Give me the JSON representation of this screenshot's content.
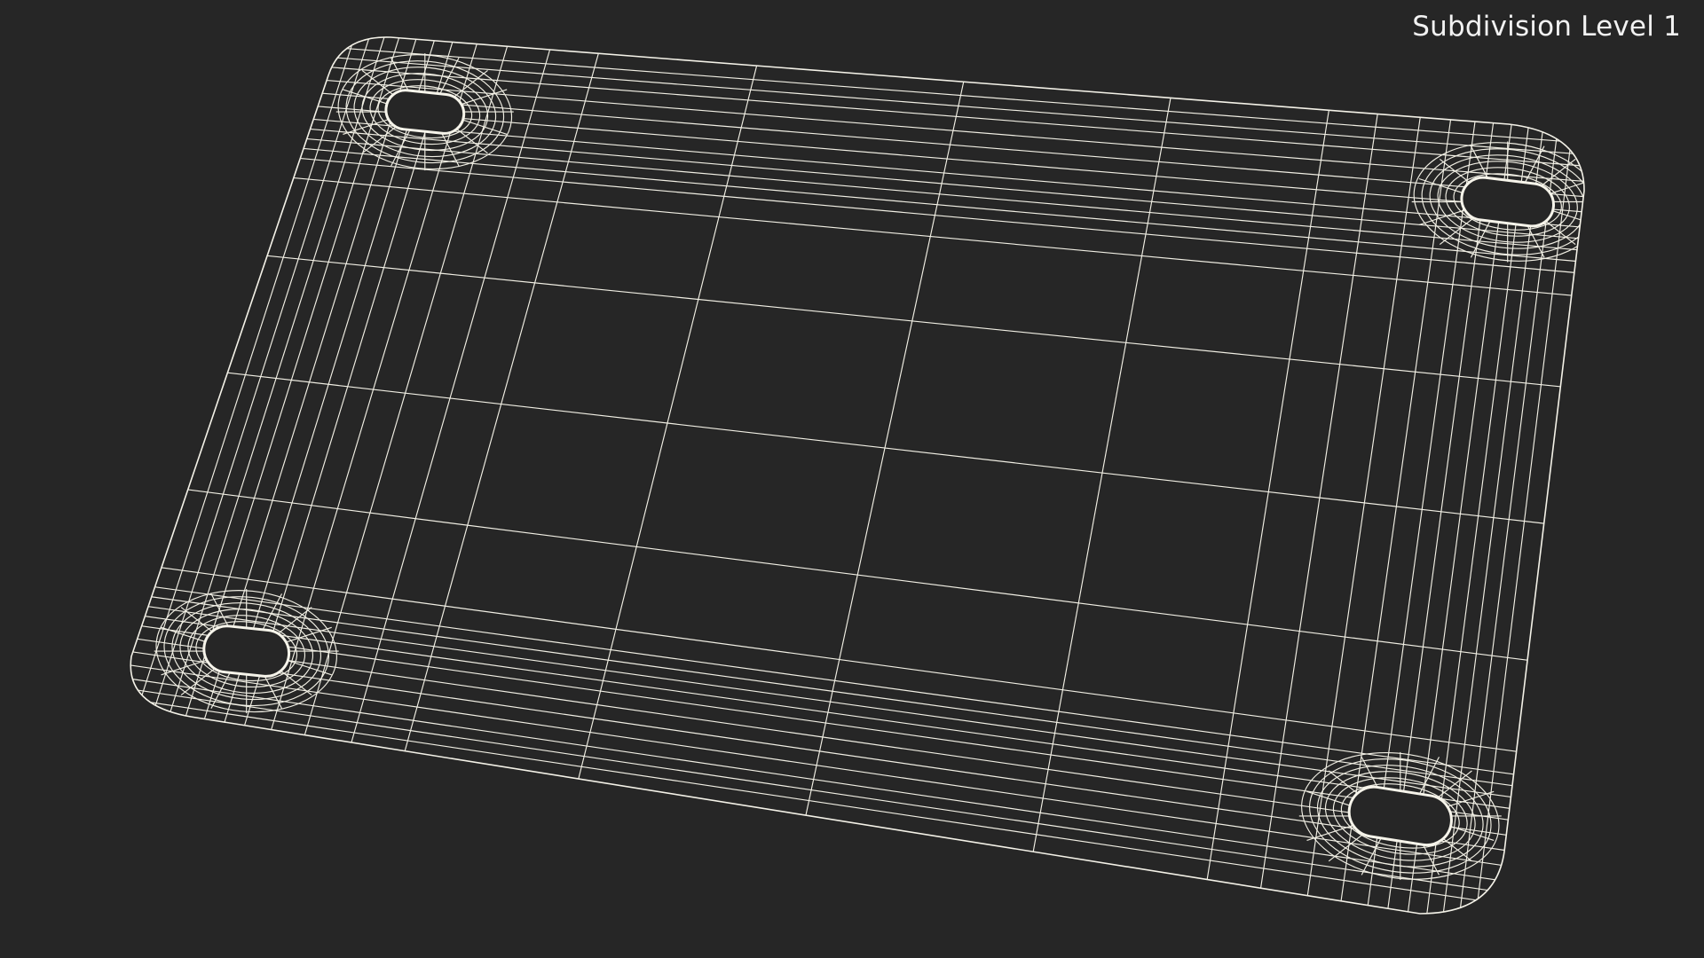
{
  "viewport": {
    "label": "Subdivision Level 1"
  },
  "colors": {
    "background": "#262626",
    "surface": "#75756b",
    "wireframe": "#f1efe4",
    "hole": "#262626"
  },
  "model": {
    "object": "plate",
    "hole_count": 4,
    "display_mode": "wireframe-on-shaded"
  }
}
